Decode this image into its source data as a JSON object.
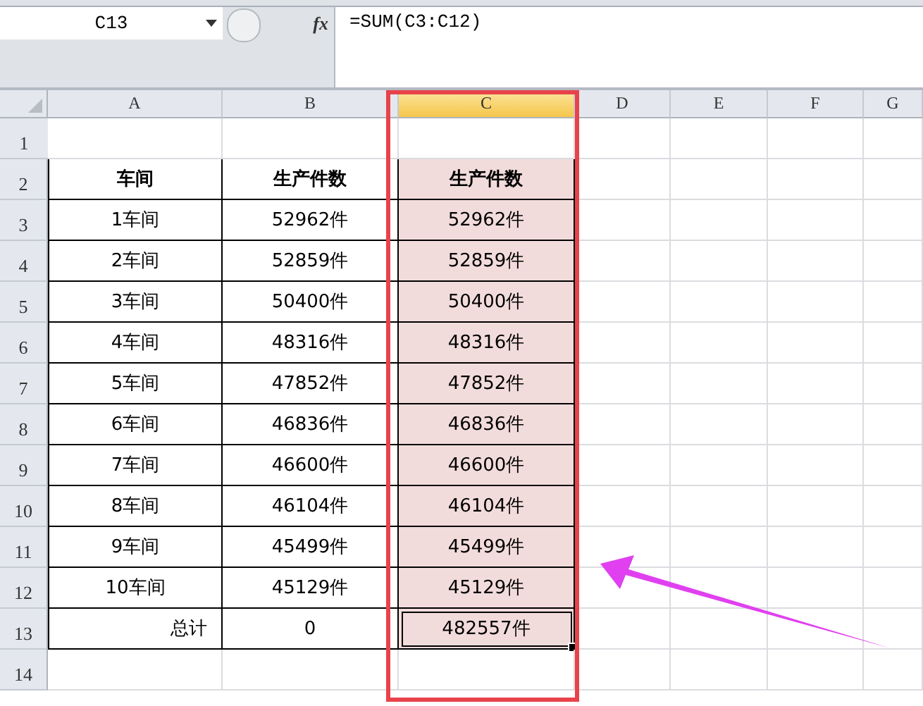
{
  "name_box": "C13",
  "function_button": "fx",
  "formula": "=SUM(C3:C12)",
  "columns": [
    {
      "label": "A",
      "selected": false,
      "shaded": false
    },
    {
      "label": "B",
      "selected": false,
      "shaded": false
    },
    {
      "label": "C",
      "selected": true,
      "shaded": true
    },
    {
      "label": "D",
      "selected": false,
      "shaded": false
    },
    {
      "label": "E",
      "selected": false,
      "shaded": false
    },
    {
      "label": "F",
      "selected": false,
      "shaded": false
    },
    {
      "label": "G",
      "selected": false,
      "shaded": false
    }
  ],
  "rows": [
    {
      "number": "1",
      "kind": "empty",
      "selected": false,
      "cells": []
    },
    {
      "number": "2",
      "kind": "header",
      "selected": false,
      "cells": [
        "车间",
        "生产件数",
        "生产件数"
      ]
    },
    {
      "number": "3",
      "kind": "data",
      "selected": false,
      "cells": [
        "1车间",
        "52962件",
        "52962件"
      ]
    },
    {
      "number": "4",
      "kind": "data",
      "selected": false,
      "cells": [
        "2车间",
        "52859件",
        "52859件"
      ]
    },
    {
      "number": "5",
      "kind": "data",
      "selected": false,
      "cells": [
        "3车间",
        "50400件",
        "50400件"
      ]
    },
    {
      "number": "6",
      "kind": "data",
      "selected": false,
      "cells": [
        "4车间",
        "48316件",
        "48316件"
      ]
    },
    {
      "number": "7",
      "kind": "data",
      "selected": false,
      "cells": [
        "5车间",
        "47852件",
        "47852件"
      ]
    },
    {
      "number": "8",
      "kind": "data",
      "selected": false,
      "cells": [
        "6车间",
        "46836件",
        "46836件"
      ]
    },
    {
      "number": "9",
      "kind": "data",
      "selected": false,
      "cells": [
        "7车间",
        "46600件",
        "46600件"
      ]
    },
    {
      "number": "10",
      "kind": "data",
      "selected": false,
      "cells": [
        "8车间",
        "46104件",
        "46104件"
      ]
    },
    {
      "number": "11",
      "kind": "data",
      "selected": false,
      "cells": [
        "9车间",
        "45499件",
        "45499件"
      ]
    },
    {
      "number": "12",
      "kind": "data",
      "selected": false,
      "cells": [
        "10车间",
        "45129件",
        "45129件"
      ]
    },
    {
      "number": "13",
      "kind": "total",
      "selected": true,
      "cells": [
        "总计",
        "0",
        "482557件"
      ]
    },
    {
      "number": "14",
      "kind": "empty",
      "selected": false,
      "cells": []
    }
  ]
}
